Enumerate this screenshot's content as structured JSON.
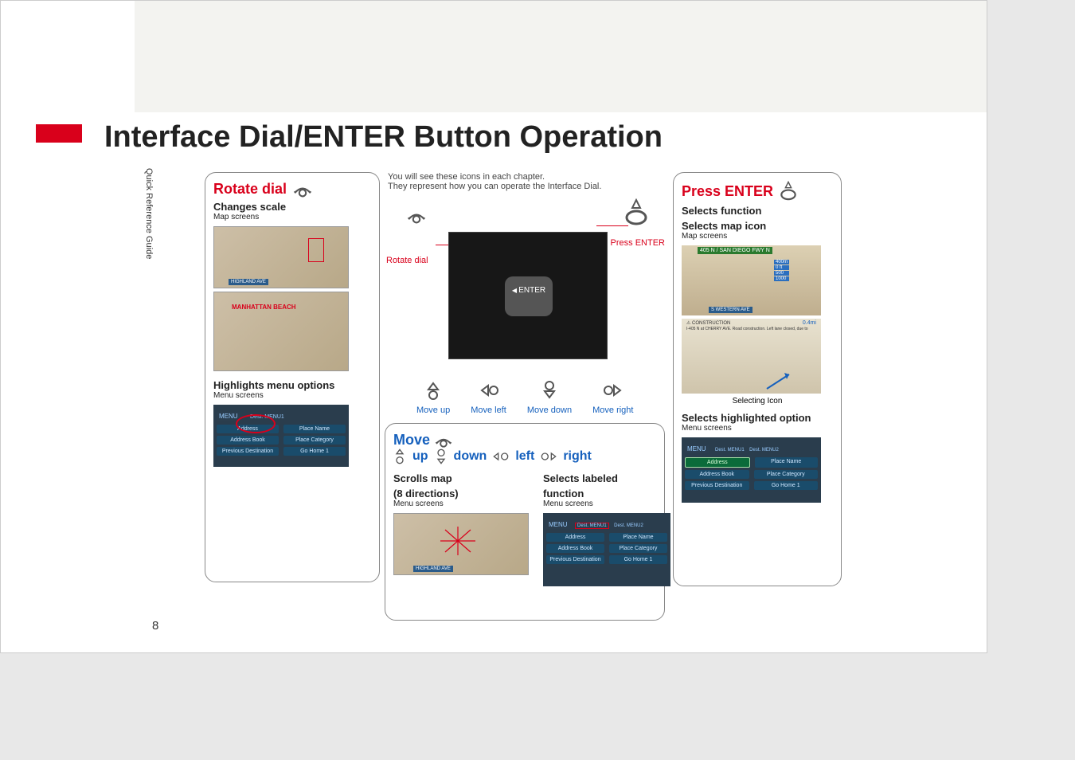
{
  "sidebar_text": "Quick Reference Guide",
  "page_number": "8",
  "title": "Interface Dial/ENTER Button Operation",
  "left_panel": {
    "rotate_label": "Rotate dial",
    "changes_scale": "Changes scale",
    "map_screens": "Map screens",
    "highlights_options": "Highlights menu options",
    "menu_screens": "Menu screens"
  },
  "center_top": {
    "line1": "You will see these icons in each chapter.",
    "line2": "They represent how you can operate the Interface Dial.",
    "rotate_dial": "Rotate dial",
    "press_enter": "Press ENTER",
    "enter_knob": "ENTER",
    "move_up": "Move up",
    "move_left": "Move left",
    "move_down": "Move down",
    "move_right": "Move right"
  },
  "center2": {
    "move": "Move",
    "up": "up",
    "down": "down",
    "left": "left",
    "right": "right",
    "scrolls_map": "Scrolls map",
    "eight_dir": "(8 directions)",
    "menu_screens": "Menu screens",
    "selects_labeled": "Selects labeled",
    "function": "function"
  },
  "right_panel": {
    "press_enter": "Press ENTER",
    "selects_function": "Selects function",
    "selects_map_icon": "Selects map icon",
    "map_screens": "Map screens",
    "selecting_icon": "Selecting Icon",
    "selects_highlighted": "Selects highlighted option",
    "menu_screens": "Menu screens"
  },
  "menu_items": {
    "hdr_left": "MENU",
    "hdr_mid": "Dest. MENU1",
    "hdr_right": "Dest. MENU2",
    "address": "Address",
    "place_name": "Place Name",
    "addr_book": "Address Book",
    "place_cat": "Place Category",
    "prev_dest": "Previous Destination",
    "go_home": "Go Home 1"
  },
  "map_text": {
    "highland": "HIGHLAND AVE",
    "manhattan": "MANHATTAN BEACH",
    "green_sign": "405  N / SAN DIEGO FWY N",
    "western": "S WESTERN AVE",
    "construction": "CONSTRUCTION",
    "constr_detail": "I-405 N at CHERRY AVE. Road construction. Left lane closed, due to",
    "dist": "0.4mi",
    "scale_400": "400m",
    "scale_0": "0 ft",
    "scale_500": "500",
    "scale_1000": "1000"
  }
}
